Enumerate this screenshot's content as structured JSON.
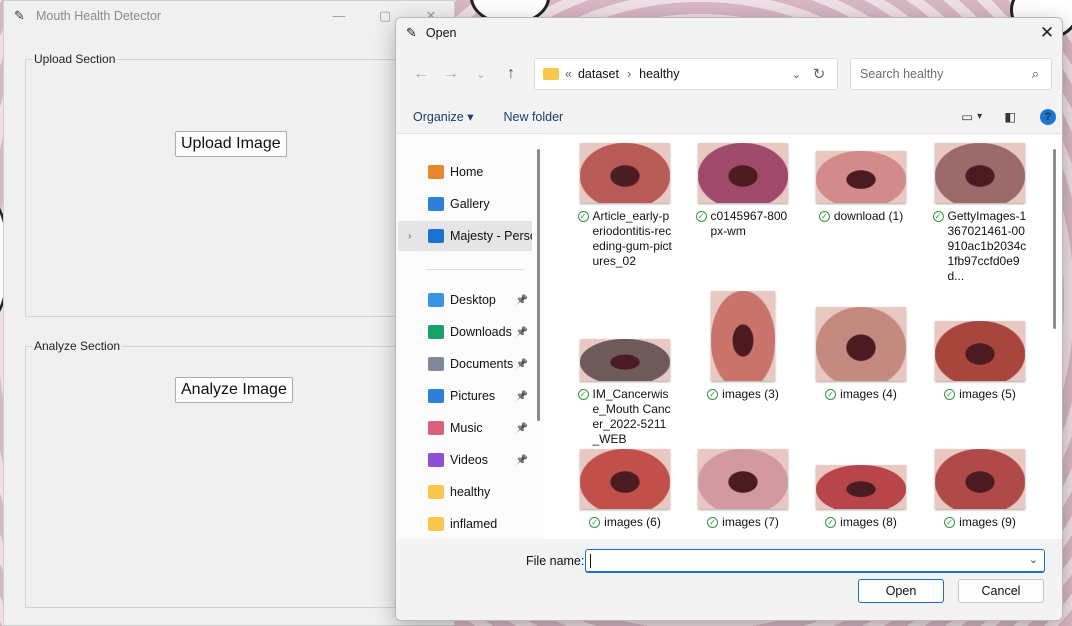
{
  "app": {
    "title": "Mouth Health Detector",
    "upload_section": {
      "legend": "Upload Section",
      "button": "Upload Image"
    },
    "analyze_section": {
      "legend": "Analyze Section",
      "button": "Analyze Image"
    }
  },
  "dialog": {
    "title": "Open",
    "address": {
      "root": "dataset",
      "current": "healthy"
    },
    "search_placeholder": "Search healthy",
    "toolbar": {
      "organize": "Organize ▾",
      "new_folder": "New folder"
    },
    "sidebar": [
      {
        "label": "Home",
        "icon": "home-icon",
        "color": "#e9872c"
      },
      {
        "label": "Gallery",
        "icon": "gallery-icon",
        "color": "#2b7fd8"
      },
      {
        "label": "Majesty - Personal",
        "icon": "onedrive-icon",
        "color": "#1a73d1"
      },
      {
        "label": "Desktop",
        "icon": "desktop-icon",
        "color": "#3a95e0"
      },
      {
        "label": "Downloads",
        "icon": "downloads-icon",
        "color": "#1aa06b"
      },
      {
        "label": "Documents",
        "icon": "documents-icon",
        "color": "#7d8a9a"
      },
      {
        "label": "Pictures",
        "icon": "pictures-icon",
        "color": "#2b7fd8"
      },
      {
        "label": "Music",
        "icon": "music-icon",
        "color": "#d9617a"
      },
      {
        "label": "Videos",
        "icon": "videos-icon",
        "color": "#8b4fd6"
      },
      {
        "label": "healthy",
        "icon": "folder-icon",
        "color": "#f7c84b"
      },
      {
        "label": "inflamed",
        "icon": "folder-icon",
        "color": "#f7c84b"
      }
    ],
    "files": [
      {
        "name": "Article_early-periodontitis-receding-gum-pictures_02",
        "color": "#b85a55"
      },
      {
        "name": "c0145967-800px-wm",
        "color": "#a04a6b"
      },
      {
        "name": "download (1)",
        "color": "#d28a8a"
      },
      {
        "name": "GettyImages-1367021461-00910ac1b2034c1fb97ccfd0e9d...",
        "color": "#9a6a6a"
      },
      {
        "name": "IM_Cancerwise_Mouth Cancer_2022-5211_WEB",
        "color": "#6e5a5a"
      },
      {
        "name": "images (3)",
        "color": "#c9736b"
      },
      {
        "name": "images (4)",
        "color": "#c48a80"
      },
      {
        "name": "images (5)",
        "color": "#a8463e"
      },
      {
        "name": "images (6)",
        "color": "#c2504a"
      },
      {
        "name": "images (7)",
        "color": "#d29aa0"
      },
      {
        "name": "images (8)",
        "color": "#b8454a"
      },
      {
        "name": "images (9)",
        "color": "#b04a48"
      }
    ],
    "file_name_label": "File name:",
    "file_name_value": "",
    "open_button": "Open",
    "cancel_button": "Cancel"
  }
}
